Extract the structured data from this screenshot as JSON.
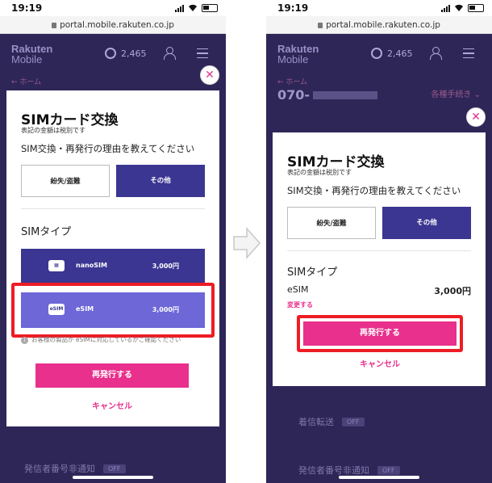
{
  "status_bar": {
    "time": "19:19"
  },
  "url": "portal.mobile.rakuten.co.jp",
  "app": {
    "brand_line1": "Rakuten",
    "brand_line2": "Mobile",
    "points": "2,465",
    "home_link": "← ホーム",
    "phone_number": "070-",
    "procedures_link": "各種手続き ⌄",
    "call_forwarding": "着信転送",
    "caller_id_hidden": "発信者番号非通知",
    "toggle_off": "OFF"
  },
  "modal": {
    "close_symbol": "✕",
    "title": "SIMカード交換",
    "subtitle": "表記の金額は税別です",
    "question": "SIM交換・再発行の理由を教えてください",
    "reason_lost": "紛失/盗難",
    "reason_other": "その他",
    "sim_type_heading": "SIMタイプ",
    "nano_name": "nanoSIM",
    "nano_price": "3,000円",
    "esim_name": "eSIM",
    "esim_icon_text": "eSIM",
    "esim_price": "3,000円",
    "note": "お客様の製品が eSIMに対応しているかご確認ください",
    "reissue_button": "再発行する",
    "cancel_button": "キャンセル",
    "change_link": "変更する"
  },
  "colors": {
    "accent_pink": "#e8308c",
    "selected_purple": "#3b3692",
    "highlight_red": "#ee1c25",
    "esim_card": "#6d67d8"
  },
  "icons": [
    "signal-icon",
    "wifi-icon",
    "battery-icon",
    "lock-icon",
    "coin-icon",
    "user-icon",
    "menu-icon",
    "close-icon",
    "sim-card-icon",
    "info-icon",
    "right-arrow-icon"
  ]
}
